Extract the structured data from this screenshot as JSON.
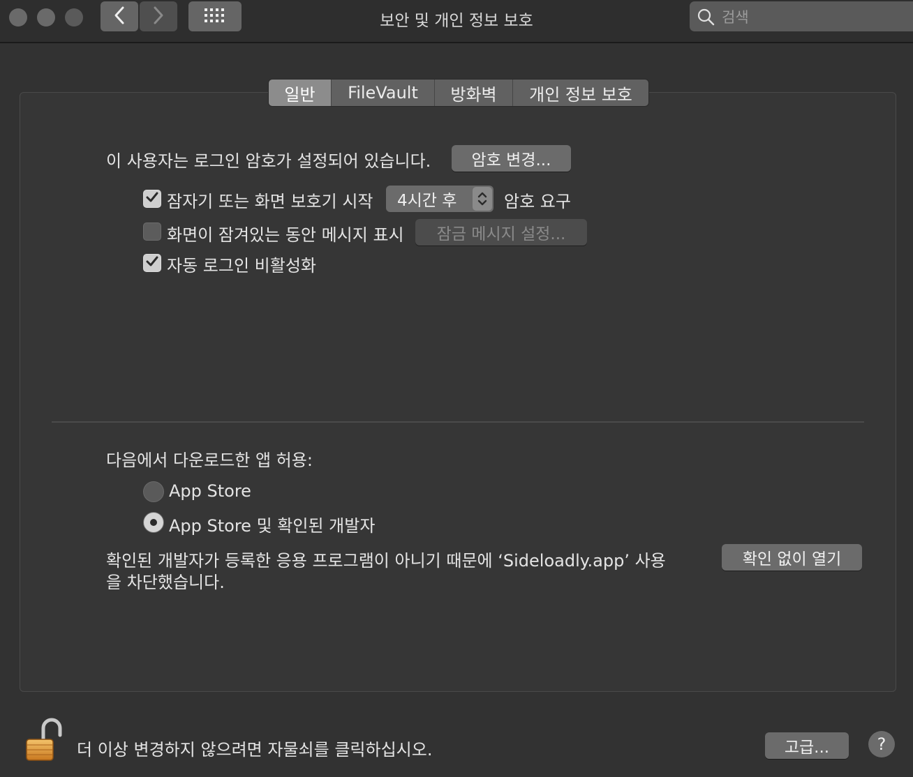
{
  "window": {
    "title": "보안 및 개인 정보 보호",
    "search_placeholder": "검색",
    "traffic_colors": [
      "#6a6a6a",
      "#6a6a6a",
      "#5a5a5a"
    ]
  },
  "tabs": [
    {
      "label": "일반",
      "active": true
    },
    {
      "label": "FileVault",
      "active": false
    },
    {
      "label": "방화벽",
      "active": false
    },
    {
      "label": "개인 정보 보호",
      "active": false
    }
  ],
  "general": {
    "password_text": "이 사용자는 로그인 암호가 설정되어 있습니다.",
    "change_password_button": "암호 변경...",
    "require_password_label": "잠자기 또는 화면 보호기 시작",
    "require_password_value": "4시간 후",
    "require_password_suffix": "암호 요구",
    "require_password_checked": true,
    "show_message_label": "화면이 잠겨있는 동안 메시지 표시",
    "show_message_checked": false,
    "set_lock_message_button": "잠금 메시지 설정...",
    "disable_autologin_label": "자동 로그인 비활성화",
    "disable_autologin_checked": true
  },
  "downloads": {
    "heading": "다음에서 다운로드한 앱 허용:",
    "options": [
      {
        "label": "App Store",
        "selected": false
      },
      {
        "label": "App Store 및 확인된 개발자",
        "selected": true
      }
    ],
    "blocked_line1": "확인된 개발자가 등록한 응용 프로그램이 아니기 때문에 ‘Sideloadly.app’ 사용",
    "blocked_line2": "을 차단했습니다.",
    "open_anyway_button": "확인 없이 열기"
  },
  "footer": {
    "lock_text": "더 이상 변경하지 않으려면 자물쇠를 클릭하십시오.",
    "advanced_button": "고급...",
    "help_label": "?"
  }
}
